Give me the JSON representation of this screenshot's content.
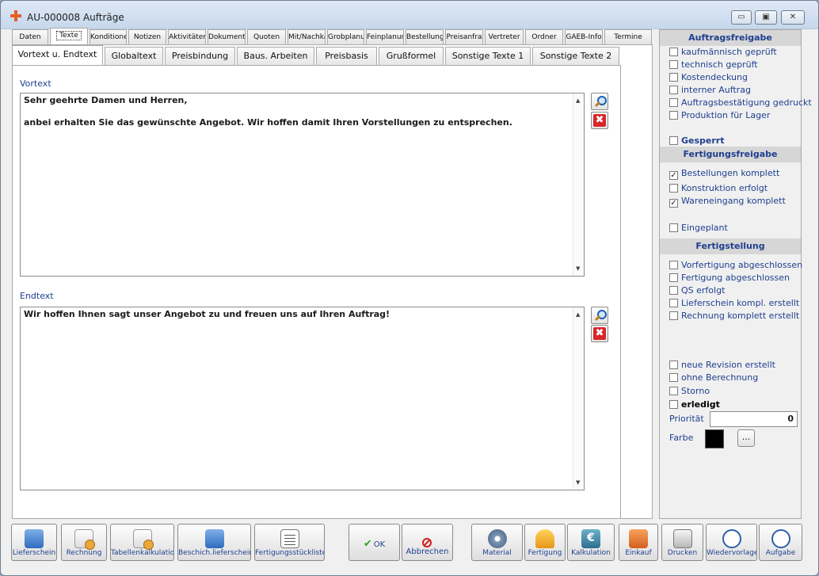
{
  "window": {
    "title": "AU-000008 Aufträge",
    "min_label": "▭",
    "max_label": "▣",
    "close_label": "✕"
  },
  "main_tabs": [
    "Daten",
    "Texte",
    "Konditione",
    "Notizen",
    "Aktivitäten",
    "Dokument",
    "Quoten",
    "Mit/Nachkä",
    "Grobplanur",
    "Feinplanun",
    "Bestellung",
    "Preisanfra",
    "Vertreter",
    "Ordner",
    "GAEB-Info",
    "Termine"
  ],
  "sub_tabs": [
    "Vortext u. Endtext",
    "Globaltext",
    "Preisbindung",
    "Baus. Arbeiten",
    "Preisbasis",
    "Grußformel",
    "Sonstige Texte 1",
    "Sonstige Texte 2"
  ],
  "vortext": {
    "label": "Vortext",
    "lines": [
      "Sehr geehrte Damen und Herren,",
      "",
      "anbei erhalten Sie das gewünschte Angebot. Wir hoffen damit Ihren Vorstellungen zu entsprechen."
    ]
  },
  "endtext": {
    "label": "Endtext",
    "lines": [
      "Wir hoffen Ihnen sagt unser Angebot zu und freuen uns auf Ihren Auftrag!"
    ]
  },
  "right": {
    "auftragsfreigabe": "Auftragsfreigabe",
    "freigabe_items": [
      {
        "label": "kaufmännisch geprüft",
        "checked": false
      },
      {
        "label": "technisch geprüft",
        "checked": false
      },
      {
        "label": "Kostendeckung",
        "checked": false
      },
      {
        "label": "interner Auftrag",
        "checked": false
      },
      {
        "label": "Auftragsbestätigung gedruckt",
        "checked": false
      },
      {
        "label": "Produktion für Lager",
        "checked": false
      }
    ],
    "gesperrt": {
      "label": "Gesperrt",
      "checked": false
    },
    "fertigungsfreigabe": "Fertigungsfreigabe",
    "fertigung_items": [
      {
        "label": "Bestellungen komplett",
        "checked": true
      },
      {
        "label": "Konstruktion erfolgt",
        "checked": false
      },
      {
        "label": "Wareneingang komplett",
        "checked": true
      }
    ],
    "eingeplant": {
      "label": "Eingeplant",
      "checked": false
    },
    "fertigstellung": "Fertigstellung",
    "fertigstellung_items": [
      {
        "label": "Vorfertigung abgeschlossen",
        "checked": false
      },
      {
        "label": "Fertigung abgeschlossen",
        "checked": false
      },
      {
        "label": "QS erfolgt",
        "checked": false
      },
      {
        "label": "Lieferschein kompl. erstellt",
        "checked": false
      },
      {
        "label": "Rechnung komplett erstellt",
        "checked": false
      }
    ],
    "misc_items": [
      {
        "label": "neue Revision erstellt",
        "checked": false
      },
      {
        "label": "ohne Berechnung",
        "checked": false
      },
      {
        "label": "Storno",
        "checked": false
      }
    ],
    "erledigt": {
      "label": "erledigt",
      "checked": false
    },
    "prioritaet_label": "Priorität",
    "prioritaet_value": "0",
    "farbe_label": "Farbe",
    "farbe_value": "#000000",
    "dots_label": "..."
  },
  "bottom": {
    "lieferschein": "Lieferschein",
    "rechnung": "Rechnung",
    "tabellenkalkulation": "Tabellenkalkulation",
    "beschich": "Beschich.lieferschein",
    "fertigungsstueckliste": "Fertigungsstückliste",
    "ok": "OK",
    "abbrechen": "Abbrechen",
    "material": "Material",
    "fertigung": "Fertigung",
    "kalkulation": "Kalkulation",
    "einkauf": "Einkauf",
    "drucken": "Drucken",
    "wiedervorlage": "Wiedervorlage",
    "aufgabe": "Aufgabe"
  }
}
